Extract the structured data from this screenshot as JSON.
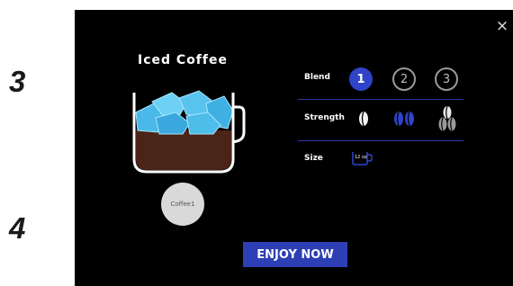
{
  "steps": {
    "step3": "3",
    "step4": "4"
  },
  "screen": {
    "close_icon_glyph": "×",
    "drink_title": "Iced Coffee",
    "coffee_button_label": "Coffee1",
    "options": {
      "blend_label": "Blend",
      "blend_values": [
        "1",
        "2",
        "3"
      ],
      "blend_selected": "1",
      "strength_label": "Strength",
      "strength_levels": 3,
      "strength_selected": 2,
      "size_label": "Size",
      "size_value": "12 oz"
    },
    "enjoy_label": "ENJOY NOW"
  },
  "colors": {
    "accent": "#2f44c9",
    "screen_bg": "#000000",
    "ice": "#5ec8f0",
    "coffee": "#4a2417"
  },
  "icons": {
    "close": "close-icon",
    "cup": "iced-coffee-cup-icon",
    "bean_light": "single-bean-icon",
    "bean_medium": "double-bean-icon",
    "bean_strong": "triple-bean-icon",
    "size_cup": "size-cup-icon"
  }
}
